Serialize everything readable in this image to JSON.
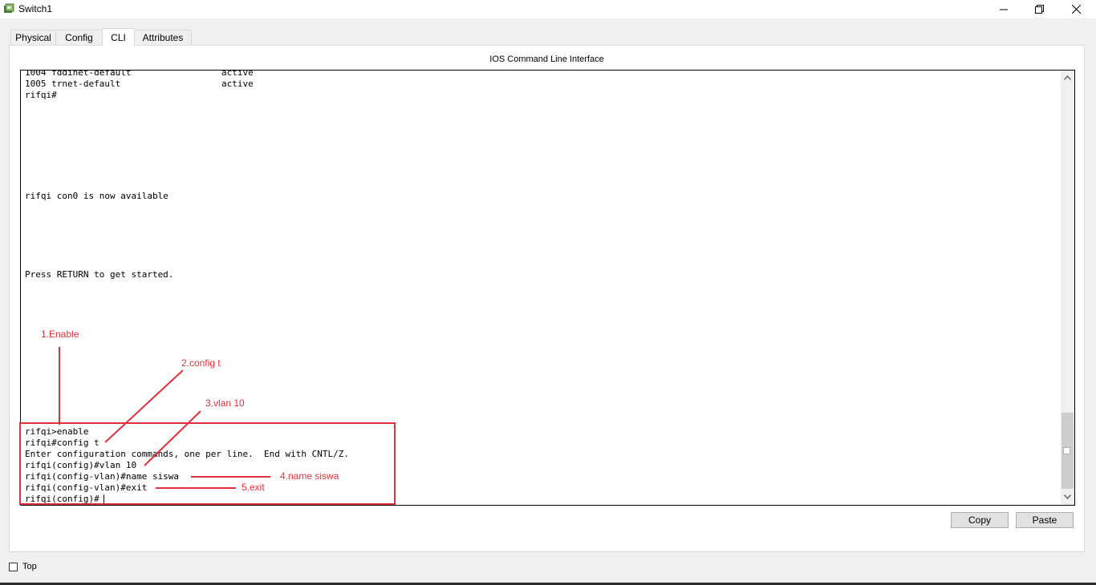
{
  "window": {
    "title": "Switch1"
  },
  "tabs": [
    {
      "label": "Physical"
    },
    {
      "label": "Config"
    },
    {
      "label": "CLI"
    },
    {
      "label": "Attributes"
    }
  ],
  "cli": {
    "heading": "IOS Command Line Interface",
    "lines": [
      "1004 fddinet-default                 active",
      "1005 trnet-default                   active",
      "rifqi#",
      "rifqi con0 is now available",
      "Press RETURN to get started.",
      "rifqi>enable",
      "rifqi#config t",
      "Enter configuration commands, one per line.  End with CNTL/Z.",
      "rifqi(config)#vlan 10",
      "rifqi(config-vlan)#name siswa",
      "rifqi(config-vlan)#exit",
      "rifqi(config)#"
    ]
  },
  "annotations": {
    "step1": "1.Enable",
    "step2": "2.config t",
    "step3": "3.vlan 10",
    "step4": "4.name siswa",
    "step5": "5.exit"
  },
  "buttons": {
    "copy": "Copy",
    "paste": "Paste"
  },
  "footer": {
    "top_checkbox_label": "Top"
  },
  "colors": {
    "annotation": "#e0303a"
  }
}
